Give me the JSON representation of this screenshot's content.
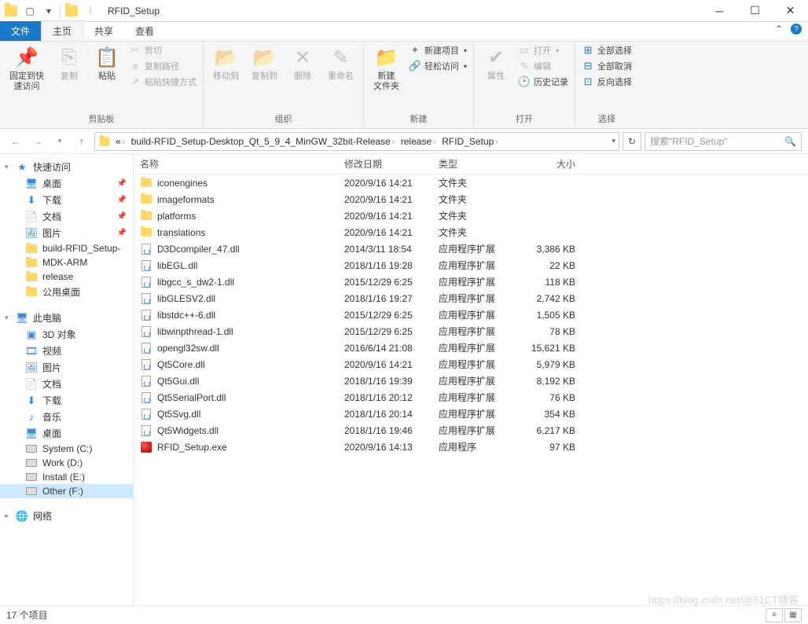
{
  "window": {
    "title": "RFID_Setup"
  },
  "tabs": {
    "file": "文件",
    "home": "主页",
    "share": "共享",
    "view": "查看"
  },
  "ribbon": {
    "clipboard": {
      "label": "剪贴板",
      "pin": "固定到快\n速访问",
      "copy": "复制",
      "paste": "粘贴",
      "cut": "剪切",
      "copypath": "复制路径",
      "pasteshortcut": "粘贴快捷方式"
    },
    "organize": {
      "label": "组织",
      "moveto": "移动到",
      "copyto": "复制到",
      "delete": "删除",
      "rename": "重命名"
    },
    "new": {
      "label": "新建",
      "newfolder": "新建\n文件夹",
      "newitem": "新建项目",
      "easyaccess": "轻松访问"
    },
    "open": {
      "label": "打开",
      "props": "属性",
      "open": "打开",
      "edit": "编辑",
      "history": "历史记录"
    },
    "select": {
      "label": "选择",
      "all": "全部选择",
      "none": "全部取消",
      "invert": "反向选择"
    }
  },
  "breadcrumbs": [
    "«",
    "build-RFID_Setup-Desktop_Qt_5_9_4_MinGW_32bit-Release",
    "release",
    "RFID_Setup"
  ],
  "search": {
    "placeholder": "搜索\"RFID_Setup\""
  },
  "navpane": {
    "quick": {
      "label": "快速访问",
      "items": [
        {
          "label": "桌面",
          "icon": "desktop",
          "pin": true
        },
        {
          "label": "下载",
          "icon": "download",
          "pin": true
        },
        {
          "label": "文档",
          "icon": "doc",
          "pin": true
        },
        {
          "label": "图片",
          "icon": "pic",
          "pin": true
        },
        {
          "label": "build-RFID_Setup-",
          "icon": "folder"
        },
        {
          "label": "MDK-ARM",
          "icon": "folder"
        },
        {
          "label": "release",
          "icon": "folder"
        },
        {
          "label": "公用桌面",
          "icon": "folder"
        }
      ]
    },
    "thispc": {
      "label": "此电脑",
      "items": [
        {
          "label": "3D 对象",
          "icon": "3d"
        },
        {
          "label": "视频",
          "icon": "video"
        },
        {
          "label": "图片",
          "icon": "pic"
        },
        {
          "label": "文档",
          "icon": "doc"
        },
        {
          "label": "下载",
          "icon": "download"
        },
        {
          "label": "音乐",
          "icon": "music"
        },
        {
          "label": "桌面",
          "icon": "desktop"
        },
        {
          "label": "System (C:)",
          "icon": "drive"
        },
        {
          "label": "Work (D:)",
          "icon": "drive"
        },
        {
          "label": "Install (E:)",
          "icon": "drive"
        },
        {
          "label": "Other (F:)",
          "icon": "drive",
          "selected": true
        }
      ]
    },
    "network": {
      "label": "网络"
    }
  },
  "columns": {
    "name": "名称",
    "date": "修改日期",
    "type": "类型",
    "size": "大小"
  },
  "files": [
    {
      "name": "iconengines",
      "date": "2020/9/16 14:21",
      "type": "文件夹",
      "size": "",
      "icon": "folder"
    },
    {
      "name": "imageformats",
      "date": "2020/9/16 14:21",
      "type": "文件夹",
      "size": "",
      "icon": "folder"
    },
    {
      "name": "platforms",
      "date": "2020/9/16 14:21",
      "type": "文件夹",
      "size": "",
      "icon": "folder"
    },
    {
      "name": "translations",
      "date": "2020/9/16 14:21",
      "type": "文件夹",
      "size": "",
      "icon": "folder"
    },
    {
      "name": "D3Dcompiler_47.dll",
      "date": "2014/3/11 18:54",
      "type": "应用程序扩展",
      "size": "3,386 KB",
      "icon": "dll"
    },
    {
      "name": "libEGL.dll",
      "date": "2018/1/16 19:28",
      "type": "应用程序扩展",
      "size": "22 KB",
      "icon": "dll"
    },
    {
      "name": "libgcc_s_dw2-1.dll",
      "date": "2015/12/29 6:25",
      "type": "应用程序扩展",
      "size": "118 KB",
      "icon": "dll"
    },
    {
      "name": "libGLESV2.dll",
      "date": "2018/1/16 19:27",
      "type": "应用程序扩展",
      "size": "2,742 KB",
      "icon": "dll"
    },
    {
      "name": "libstdc++-6.dll",
      "date": "2015/12/29 6:25",
      "type": "应用程序扩展",
      "size": "1,505 KB",
      "icon": "dll"
    },
    {
      "name": "libwinpthread-1.dll",
      "date": "2015/12/29 6:25",
      "type": "应用程序扩展",
      "size": "78 KB",
      "icon": "dll"
    },
    {
      "name": "opengl32sw.dll",
      "date": "2016/6/14 21:08",
      "type": "应用程序扩展",
      "size": "15,621 KB",
      "icon": "dll"
    },
    {
      "name": "Qt5Core.dll",
      "date": "2020/9/16 14:21",
      "type": "应用程序扩展",
      "size": "5,979 KB",
      "icon": "dll"
    },
    {
      "name": "Qt5Gui.dll",
      "date": "2018/1/16 19:39",
      "type": "应用程序扩展",
      "size": "8,192 KB",
      "icon": "dll"
    },
    {
      "name": "Qt5SerialPort.dll",
      "date": "2018/1/16 20:12",
      "type": "应用程序扩展",
      "size": "76 KB",
      "icon": "dll"
    },
    {
      "name": "Qt5Svg.dll",
      "date": "2018/1/16 20:14",
      "type": "应用程序扩展",
      "size": "354 KB",
      "icon": "dll"
    },
    {
      "name": "Qt5Widgets.dll",
      "date": "2018/1/16 19:46",
      "type": "应用程序扩展",
      "size": "6,217 KB",
      "icon": "dll"
    },
    {
      "name": "RFID_Setup.exe",
      "date": "2020/9/16 14:13",
      "type": "应用程序",
      "size": "97 KB",
      "icon": "exe"
    }
  ],
  "status": {
    "count": "17 个项目"
  },
  "watermark": "https://blog.csdn.net/@51CT博客"
}
